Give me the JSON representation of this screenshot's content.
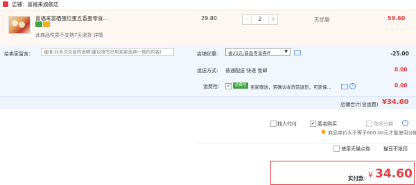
{
  "shop": {
    "label": "店铺：喜福来旗舰店"
  },
  "item": {
    "title": "喜福来富硒蛋红蛋五香蛋零食...",
    "note": "此商品性质不支持7天退货 详情",
    "price": "29.80",
    "quantity": "2",
    "minus": "-",
    "plus": "+",
    "discount": "无优惠",
    "subtotal": "59.60"
  },
  "options": {
    "message_label": "给卖家留言：",
    "message_placeholder": "选填:对本次交易的说明(建议填写已和卖家协商一致的内容)",
    "shop_coupon_label": "店铺优惠:",
    "shop_coupon_value": "省25元:新品专享券ff",
    "shop_coupon_amount": "-25.00",
    "shipping_label": "运送方式:",
    "shipping_value": "普通配送 快递 免邮",
    "shipping_amount": "0.00",
    "insurance_label": "运费险:",
    "insurance_badge": "运费险",
    "insurance_text": "卖家赠送，若确认收货前退货，可获保...",
    "insurance_amount": "0.00",
    "total_label": "店铺合计(含运费)",
    "total_value": "¥34.60"
  },
  "bottom": {
    "proxy_pay": "找人代付",
    "anonymous": "匿名购买",
    "installment": "花呗分期",
    "installment_note": "商品单价大于等于600.00元才能使用分期",
    "tmall_points": "使用天猫点券",
    "points_no_offset": "猫豆不抵扣"
  },
  "pay": {
    "label": "实付款：",
    "currency": "¥",
    "amount": "34.60"
  },
  "colors": {
    "accent": "#e4393c",
    "link": "#4a90e2",
    "success": "#40a340"
  }
}
